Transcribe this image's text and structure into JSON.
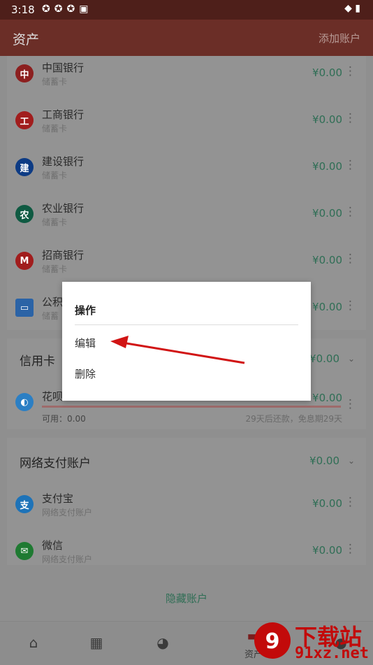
{
  "status_bar": {
    "time": "3:18",
    "icons": [
      "notification-icon",
      "notification-icon",
      "notification-icon",
      "font-icon"
    ],
    "right_icons": "◆ ▮"
  },
  "app_bar": {
    "title": "资产",
    "action": "添加账户"
  },
  "banks": [
    {
      "name": "中国银行",
      "type": "储蓄卡",
      "amount": "¥0.00",
      "icon": "boc-icon",
      "color": "#8c1f1f",
      "glyph": "中"
    },
    {
      "name": "工商银行",
      "type": "储蓄卡",
      "amount": "¥0.00",
      "icon": "icbc-icon",
      "color": "#a11d1d",
      "glyph": "工"
    },
    {
      "name": "建设银行",
      "type": "储蓄卡",
      "amount": "¥0.00",
      "icon": "ccb-icon",
      "color": "#0d3b84",
      "glyph": "建"
    },
    {
      "name": "农业银行",
      "type": "储蓄卡",
      "amount": "¥0.00",
      "icon": "abc-icon",
      "color": "#0f5a42",
      "glyph": "农"
    },
    {
      "name": "招商银行",
      "type": "储蓄卡",
      "amount": "¥0.00",
      "icon": "cmb-icon",
      "color": "#a11d1d",
      "glyph": "M"
    },
    {
      "name": "公积",
      "type": "储蓄",
      "amount": "¥0.00",
      "icon": "card-icon",
      "color": "#2b63a6",
      "glyph": "▭"
    }
  ],
  "credit": {
    "section_title": "信用卡",
    "section_amount": "¥0.00",
    "item": {
      "name": "花呗",
      "amount": "¥0.00",
      "available": "可用：0.00",
      "note": "29天后还款，免息期29天",
      "color": "#2b7fc4",
      "progress": 1.0
    }
  },
  "online": {
    "section_title": "网络支付账户",
    "section_amount": "¥0.00",
    "items": [
      {
        "name": "支付宝",
        "type": "网络支付账户",
        "amount": "¥0.00",
        "icon": "alipay-icon",
        "color": "#1e73b8",
        "glyph": "支"
      },
      {
        "name": "微信",
        "type": "网络支付账户",
        "amount": "¥0.00",
        "icon": "wechat-icon",
        "color": "#1f7a32",
        "glyph": "✉"
      }
    ]
  },
  "hidden_accounts": "隐藏账户",
  "nav": [
    {
      "label": "",
      "icon": "home-icon",
      "glyph": "⌂"
    },
    {
      "label": "",
      "icon": "calendar-icon",
      "glyph": "▦"
    },
    {
      "label": "",
      "icon": "chart-icon",
      "glyph": "◕"
    },
    {
      "label": "资产",
      "icon": "wallet-icon",
      "glyph": "▬"
    },
    {
      "label": "",
      "icon": "user-icon",
      "glyph": "●"
    }
  ],
  "dialog": {
    "title": "操作",
    "edit": "编辑",
    "delete": "删除"
  },
  "watermark": {
    "line1": "下载站",
    "line2": "91xz.net",
    "logo": "9"
  },
  "colors": {
    "accent_green": "#2f6e55",
    "app_bar": "#6b2e27",
    "annotation_red": "#d11414"
  }
}
